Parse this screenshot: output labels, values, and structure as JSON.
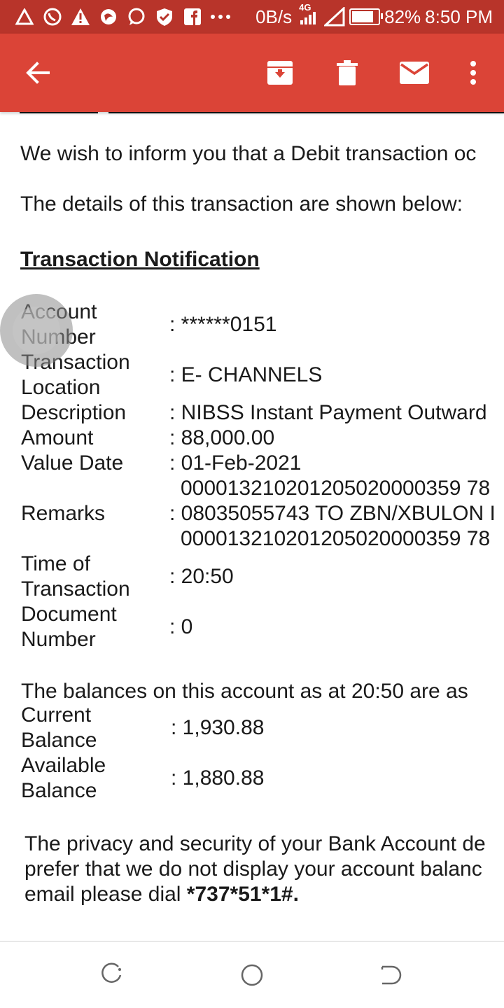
{
  "status_bar": {
    "network_speed": "0B/s",
    "network_type": "4G",
    "battery": "82%",
    "battery_level": 0.82,
    "time": "8:50 PM",
    "notification_icons": [
      "alert-triangle-outline-icon",
      "whatsapp-icon",
      "warning-icon",
      "bird-app-icon",
      "chat-bubble-icon",
      "shield-check-icon",
      "facebook-icon",
      "more-dots-icon"
    ]
  },
  "app_bar": {
    "color": "#db4437",
    "statusbar_color": "#b8342a",
    "actions": [
      "back-arrow-icon",
      "archive-icon",
      "delete-icon",
      "mark-unread-icon",
      "more-vert-icon"
    ]
  },
  "email": {
    "intro": "We wish to inform you that a Debit transaction oc",
    "details_intro": "The details of this transaction are shown below:",
    "heading": "Transaction Notification",
    "fields": [
      {
        "label": "Account Number",
        "value": ": ******0151"
      },
      {
        "label": "Transaction Location",
        "value": ": E- CHANNELS"
      },
      {
        "label": "Description",
        "value": ": NIBSS Instant Payment Outward"
      },
      {
        "label": "Amount",
        "value": ": 88,000.00"
      },
      {
        "label": "Value Date",
        "value": ": 01-Feb-2021"
      },
      {
        "label": "Remarks",
        "value_lines": [
          "000013210201205020000359 78",
          ": 08035055743 TO ZBN/XBULON I",
          "000013210201205020000359 78"
        ]
      },
      {
        "label": "Time of Transaction",
        "value": ": 20:50"
      },
      {
        "label": "Document Number",
        "value": ": 0"
      }
    ],
    "balances_intro": "The balances on this account as at  20:50  are as",
    "balances": [
      {
        "label": "Current Balance",
        "value": ": 1,930.88"
      },
      {
        "label": "Available Balance",
        "value": ": 1,880.88"
      }
    ],
    "footer_lines": [
      "The privacy and security of your Bank Account de",
      "prefer that we do not display your account balanc",
      "email please dial "
    ],
    "ussd_code": "*737*51*1#."
  },
  "nav_bar": {
    "buttons": [
      "recent-apps-icon",
      "home-icon",
      "back-icon"
    ]
  }
}
